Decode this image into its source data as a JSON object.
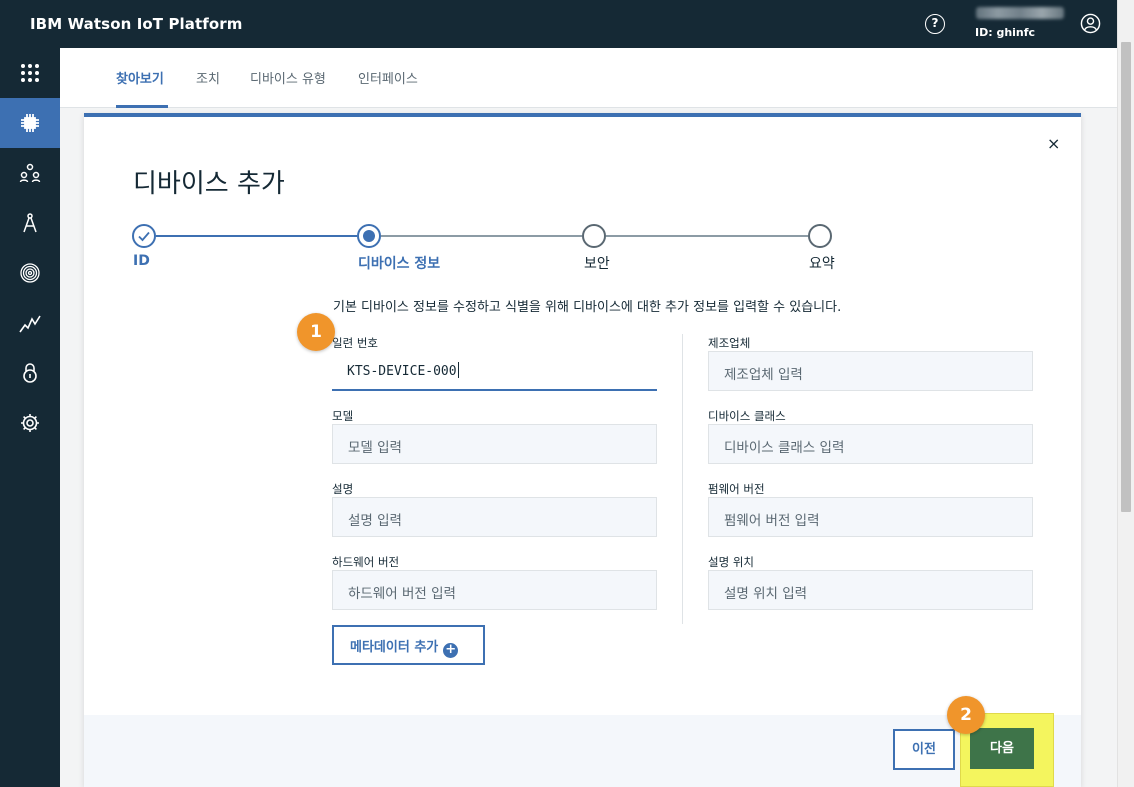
{
  "header": {
    "brand": "IBM Watson IoT Platform",
    "help_icon": "?",
    "user_id": "ID: ghinfc"
  },
  "sidenav": {
    "items": [
      {
        "icon": "apps-grid-icon"
      },
      {
        "icon": "device-chip-icon",
        "active": true
      },
      {
        "icon": "members-icon"
      },
      {
        "icon": "compass-icon"
      },
      {
        "icon": "fingerprint-icon"
      },
      {
        "icon": "usage-chart-icon"
      },
      {
        "icon": "lock-icon"
      },
      {
        "icon": "settings-gear-icon"
      }
    ]
  },
  "subtabs": [
    "찾아보기",
    "조치",
    "디바이스 유형",
    "인터페이스"
  ],
  "modal": {
    "close_icon": "×",
    "title": "디바이스 추가",
    "steps": [
      "ID",
      "디바이스 정보",
      "보안",
      "요약"
    ],
    "description": "기본 디바이스 정보를 수정하고 식별을 위해 디바이스에 대한 추가 정보를 입력할 수 있습니다.",
    "left_fields": [
      {
        "label": "일련 번호",
        "value": "KTS-DEVICE-000"
      },
      {
        "label": "모델",
        "placeholder": "모델 입력"
      },
      {
        "label": "설명",
        "placeholder": "설명 입력"
      },
      {
        "label": "하드웨어 버전",
        "placeholder": "하드웨어 버전 입력"
      }
    ],
    "right_fields": [
      {
        "label": "제조업체",
        "placeholder": "제조업체 입력"
      },
      {
        "label": "디바이스 클래스",
        "placeholder": "디바이스 클래스 입력"
      },
      {
        "label": "펌웨어 버전",
        "placeholder": "펌웨어 버전 입력"
      },
      {
        "label": "설명 위치",
        "placeholder": "설명 위치 입력"
      }
    ],
    "metadata_button": "메타데이터 추가",
    "prev_button": "이전",
    "next_button": "다음"
  },
  "annotations": {
    "badge1": "1",
    "badge2": "2"
  },
  "colors": {
    "nav_bg": "#152935",
    "accent": "#3d70b2",
    "next_button": "#3e7449",
    "badge": "#f0952b",
    "highlight": "#f4f55e"
  }
}
